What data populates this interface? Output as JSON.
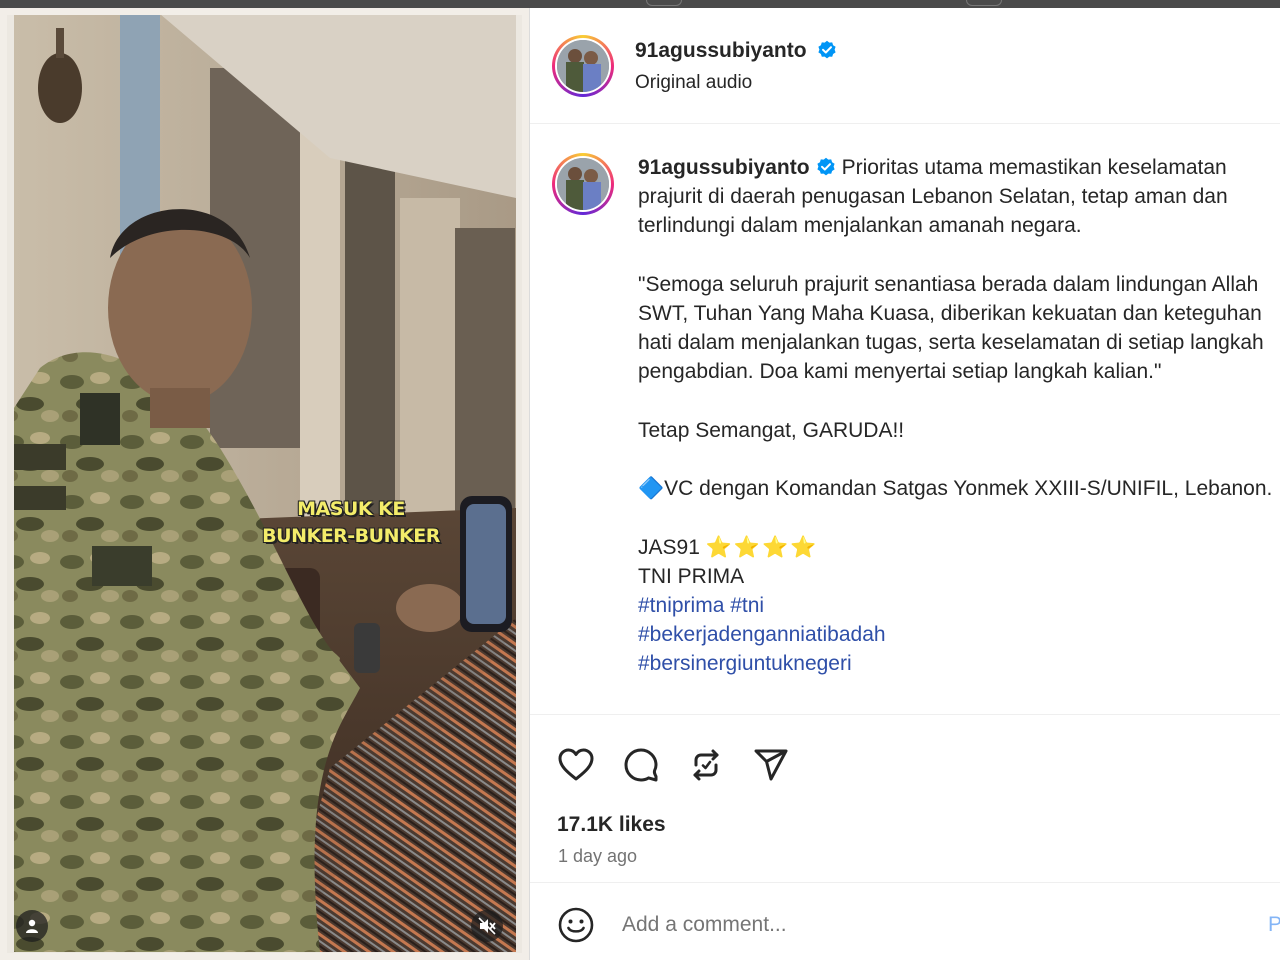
{
  "media": {
    "overlay_text": "MASUK KE BUNKER-BUNKER",
    "user_tag_icon": "person-icon",
    "mute_icon": "speaker-muted-icon"
  },
  "header": {
    "username": "91agussubiyanto",
    "verified_icon": "verified-badge-icon",
    "audio_label": "Original audio"
  },
  "caption": {
    "username": "91agussubiyanto",
    "paragraphs": [
      "Prioritas utama memastikan keselamatan prajurit di daerah penugasan Lebanon Selatan, tetap aman dan terlindungi dalam menjalankan amanah negara.",
      "\"Semoga seluruh prajurit senantiasa berada dalam lindungan Allah SWT, Tuhan Yang Maha Kuasa, diberikan kekuatan dan keteguhan hati dalam menjalankan tugas, serta keselamatan di setiap langkah pengabdian. Doa kami menyertai setiap langkah kalian.\"",
      "Tetap Semangat, GARUDA!!",
      "🔷VC dengan Komandan Satgas Yonmek XXIII-S/UNIFIL, Lebanon."
    ],
    "signature_line1": "JAS91",
    "signature_stars": "⭐⭐⭐⭐",
    "signature_line2": "TNI PRIMA",
    "hashtags_line1": "#tniprima #tni",
    "hashtags_line2": "#bekerjadenganniatibadah",
    "hashtags_line3": "#bersinergiuntuknegeri"
  },
  "actions": {
    "like_icon": "heart-icon",
    "comment_icon": "comment-bubble-icon",
    "repost_icon": "repost-icon",
    "share_icon": "send-icon",
    "likes": "17.1K likes",
    "time_ago": "1 day ago"
  },
  "comment": {
    "emoji_icon": "smiley-icon",
    "placeholder": "Add a comment...",
    "post_label": "Post"
  }
}
